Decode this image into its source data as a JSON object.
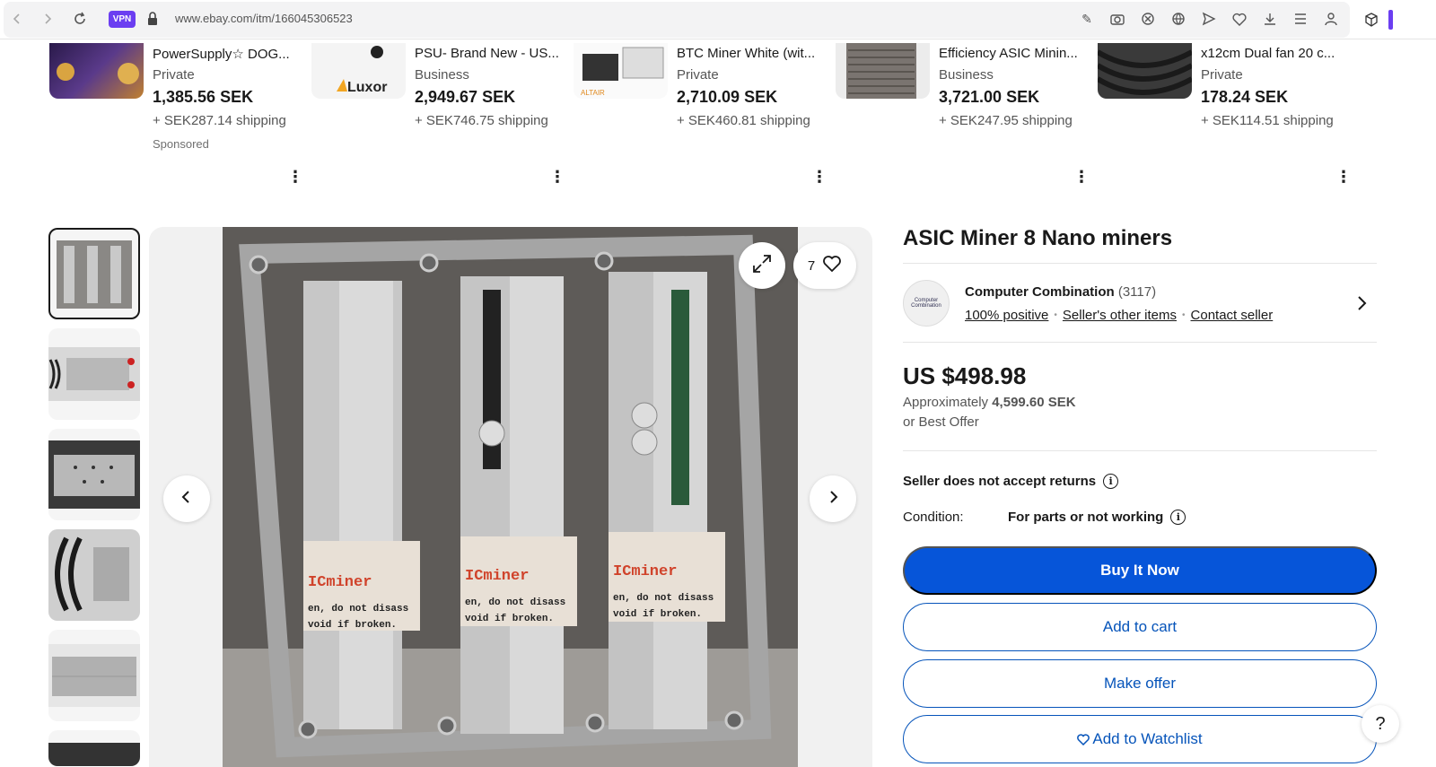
{
  "browser": {
    "url": "www.ebay.com/itm/166045306523",
    "vpn_label": "VPN"
  },
  "carousel": [
    {
      "title": "PowerSupply☆ DOG...",
      "seller": "Private",
      "price": "1,385.56 SEK",
      "shipping": "+ SEK287.14 shipping",
      "sponsored": "Sponsored"
    },
    {
      "title": "PSU- Brand New - US...",
      "seller": "Business",
      "price": "2,949.67 SEK",
      "shipping": "+ SEK746.75 shipping",
      "thumb_text": "Luxor"
    },
    {
      "title": "BTC Miner White (wit...",
      "seller": "Private",
      "price": "2,710.09 SEK",
      "shipping": "+ SEK460.81 shipping",
      "thumb_text": "ALTAIR"
    },
    {
      "title": "Efficiency ASIC Minin...",
      "seller": "Business",
      "price": "3,721.00 SEK",
      "shipping": "+ SEK247.95 shipping"
    },
    {
      "title": "x12cm Dual fan 20 c...",
      "seller": "Private",
      "price": "178.24 SEK",
      "shipping": "+ SEK114.51 shipping"
    }
  ],
  "gallery": {
    "watch_count": "7",
    "label_lines": [
      "ICminer",
      "en, do not disass",
      "void if broken."
    ]
  },
  "listing": {
    "title": "ASIC Miner 8 Nano miners",
    "seller_name": "Computer Combination",
    "seller_count": "(3117)",
    "seller_logo_text": "Computer Combination",
    "positive": "100% positive",
    "other_items": "Seller's other items",
    "contact": "Contact seller",
    "price": "US $498.98",
    "approx_label": "Approximately",
    "approx_value": "4,599.60 SEK",
    "best_offer": "or Best Offer",
    "returns": "Seller does not accept returns",
    "condition_label": "Condition:",
    "condition_value": "For parts or not working",
    "buy_now": "Buy It Now",
    "add_to_cart": "Add to cart",
    "make_offer": "Make offer",
    "add_to_watchlist": "Add to Watchlist"
  },
  "help_label": "?",
  "colors": {
    "accent": "#0654ba",
    "vpn": "#6b3ef1"
  }
}
